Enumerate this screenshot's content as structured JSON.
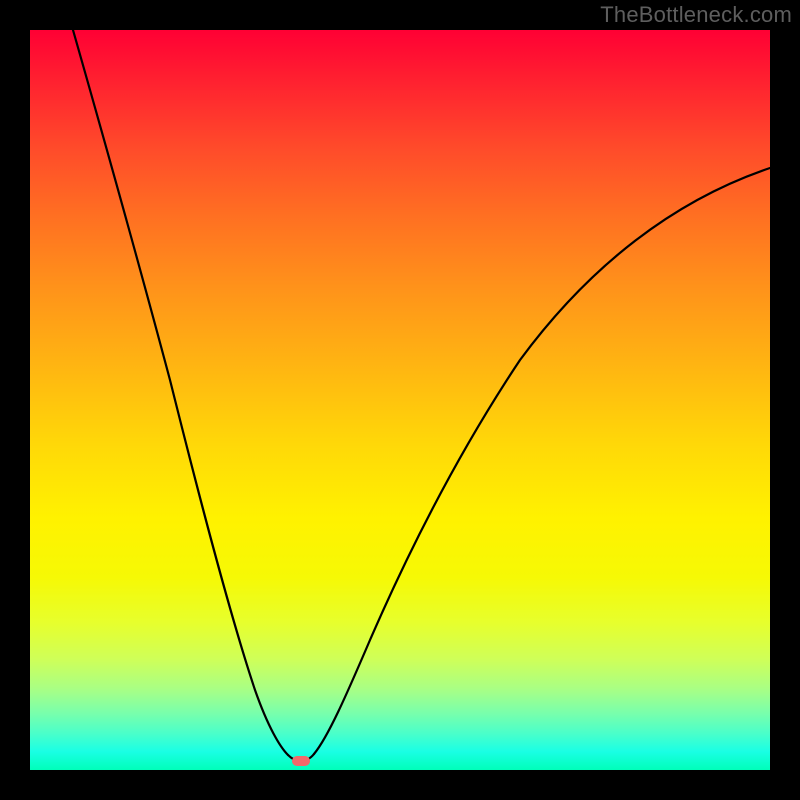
{
  "watermark": "TheBottleneck.com",
  "marker_style": "left:271px; top:731px;",
  "colors": {
    "gradient_top": "#ff0034",
    "gradient_bottom": "#00ffb9",
    "curve": "#000000",
    "marker": "#f26a6a",
    "frame": "#000000"
  },
  "chart_data": {
    "type": "line",
    "title": "",
    "xlabel": "",
    "ylabel": "",
    "xlim": [
      0,
      100
    ],
    "ylim": [
      0,
      100
    ],
    "legend": null,
    "grid": false,
    "notes": "Axes are unlabeled in the source image; x and y are normalized 0–100 to the plot area. y is read as height above the bottom edge (0 = bottom/green, 100 = top/red). Values are estimated from pixel positions.",
    "series": [
      {
        "name": "bottleneck-curve",
        "x": [
          5.8,
          10,
          15,
          20,
          25,
          28,
          30,
          32,
          34,
          36.6,
          40,
          45,
          50,
          55,
          60,
          65,
          70,
          75,
          80,
          85,
          90,
          95,
          100
        ],
        "y": [
          100,
          86,
          70,
          53,
          34,
          20,
          12,
          6,
          2.5,
          1.2,
          4,
          12,
          25,
          37,
          47,
          56,
          63,
          69,
          73,
          76.5,
          79,
          80.5,
          81.5
        ]
      }
    ],
    "annotations": [
      {
        "name": "optimum-marker",
        "x": 36.6,
        "y": 1.2,
        "label": ""
      }
    ],
    "background_gradient": {
      "orientation": "vertical",
      "stops": [
        {
          "pos": 0.0,
          "color": "#ff0034"
        },
        {
          "pos": 0.25,
          "color": "#ff6f22"
        },
        {
          "pos": 0.5,
          "color": "#ffc80c"
        },
        {
          "pos": 0.7,
          "color": "#fff200"
        },
        {
          "pos": 0.9,
          "color": "#7effa8"
        },
        {
          "pos": 1.0,
          "color": "#00ffb9"
        }
      ]
    }
  }
}
